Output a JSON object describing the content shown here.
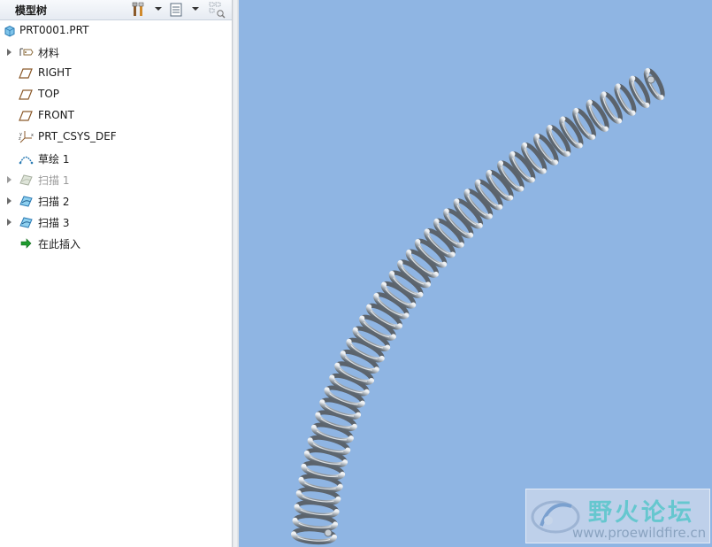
{
  "model_tree": {
    "title": "模型树",
    "toolbar": [
      {
        "icon": "settings-tools-icon",
        "has_dropdown": true
      },
      {
        "icon": "tree-columns-icon",
        "has_dropdown": true
      },
      {
        "icon": "show-hide-filter-icon",
        "has_dropdown": false
      }
    ],
    "items": [
      {
        "label": "PRT0001.PRT",
        "icon": "part-icon",
        "expandable": false,
        "dimmed": false
      },
      {
        "label": "材料",
        "icon": "material-tag-icon",
        "expandable": true,
        "dimmed": false
      },
      {
        "label": "RIGHT",
        "icon": "datum-plane-icon",
        "expandable": false,
        "dimmed": false
      },
      {
        "label": "TOP",
        "icon": "datum-plane-icon",
        "expandable": false,
        "dimmed": false
      },
      {
        "label": "FRONT",
        "icon": "datum-plane-icon",
        "expandable": false,
        "dimmed": false
      },
      {
        "label": "PRT_CSYS_DEF",
        "icon": "coordinate-system-icon",
        "expandable": false,
        "dimmed": false
      },
      {
        "label": "草绘 1",
        "icon": "sketch-icon",
        "expandable": false,
        "dimmed": false
      },
      {
        "label": "扫描 1",
        "icon": "sweep-icon",
        "expandable": true,
        "dimmed": true
      },
      {
        "label": "扫描 2",
        "icon": "sweep-icon",
        "expandable": true,
        "dimmed": false
      },
      {
        "label": "扫描 3",
        "icon": "sweep-icon",
        "expandable": true,
        "dimmed": false
      },
      {
        "label": "在此插入",
        "icon": "insert-here-arrow-icon",
        "expandable": false,
        "dimmed": false
      }
    ]
  },
  "graphics": {
    "background_color": "#8fb5e3",
    "model": "swept-coil-spring",
    "watermark": {
      "title": "野火论坛",
      "url": "www.proewildfire.cn"
    }
  }
}
